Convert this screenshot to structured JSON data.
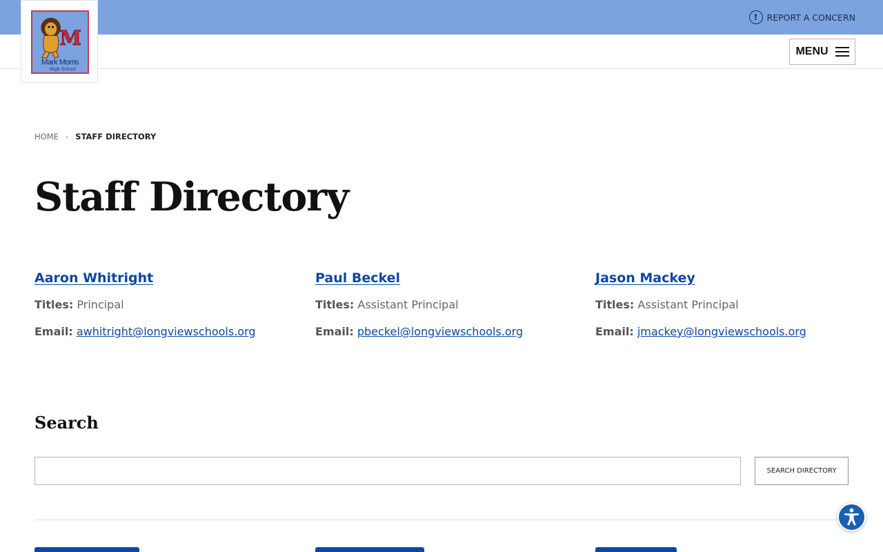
{
  "header": {
    "report_label": "REPORT A CONCERN",
    "menu_label": "MENU",
    "logo": {
      "line1": "Mark Morris",
      "line2": "High School",
      "letter": "M"
    }
  },
  "breadcrumb": {
    "home": "HOME",
    "current": "STAFF DIRECTORY"
  },
  "page_title": "Staff Directory",
  "field_labels": {
    "titles": "Titles:",
    "email": "Email:"
  },
  "staff": [
    {
      "name": "Aaron Whitright",
      "title": "Principal",
      "email": "awhitright@longviewschools.org"
    },
    {
      "name": "Paul Beckel",
      "title": "Assistant Principal",
      "email": "pbeckel@longviewschools.org"
    },
    {
      "name": "Jason Mackey",
      "title": "Assistant Principal",
      "email": "jmackey@longviewschools.org"
    }
  ],
  "search": {
    "heading": "Search",
    "input_value": "",
    "placeholder": "",
    "button_label": "SEARCH DIRECTORY"
  },
  "colors": {
    "header_bar": "#7ca3e0",
    "link": "#0d47a1",
    "accessibility": "#1a5fb4",
    "logo_border": "#c43c50"
  },
  "icons": {
    "report": "alert-circle-icon",
    "menu": "hamburger-icon",
    "accessibility": "accessibility-person-icon",
    "breadcrumb_separator": "chevron-right-icon"
  }
}
